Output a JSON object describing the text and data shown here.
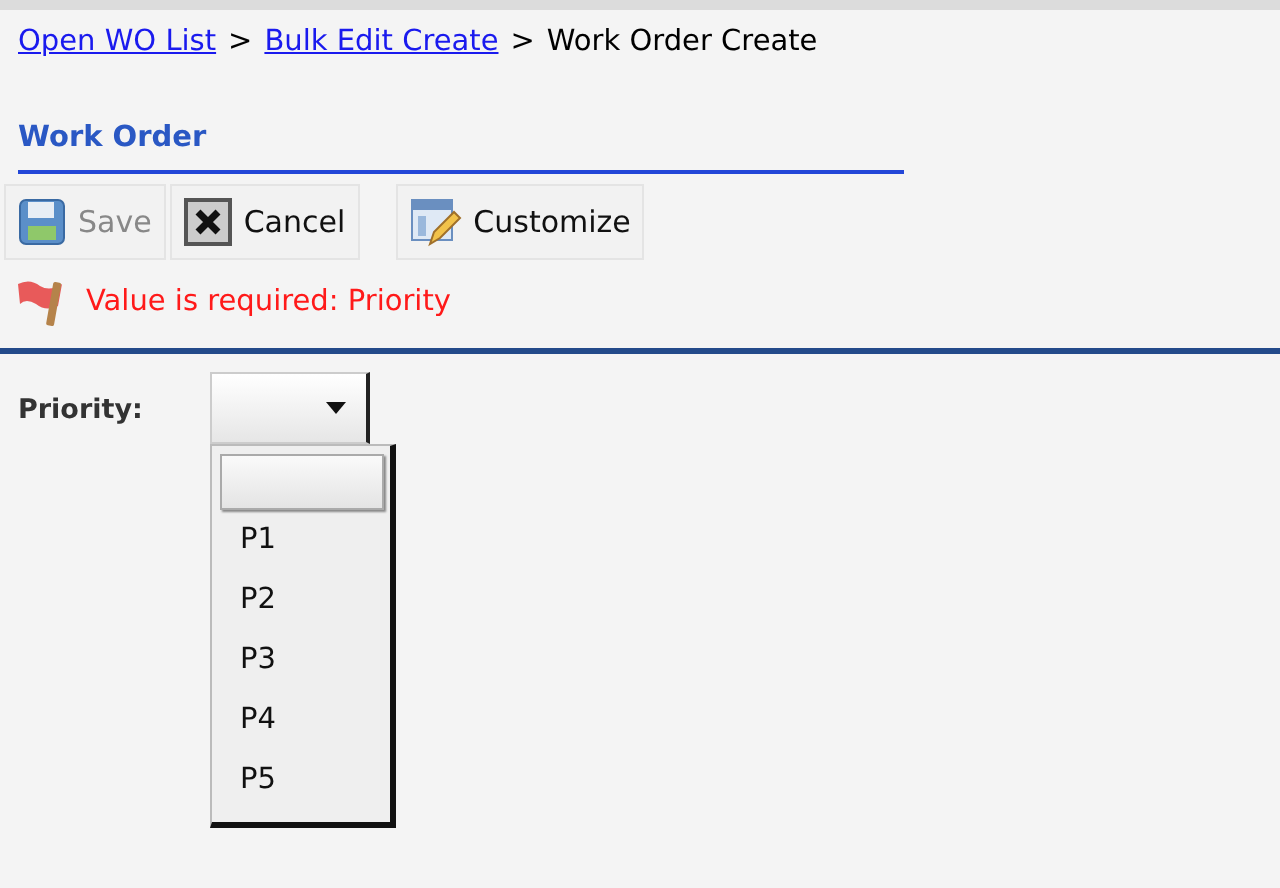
{
  "breadcrumb": {
    "links": [
      "Open WO List",
      "Bulk Edit Create"
    ],
    "separator": ">",
    "current": "Work Order Create"
  },
  "section_title": "Work Order",
  "toolbar": [
    {
      "kind": "save",
      "label": "Save",
      "disabled": true
    },
    {
      "kind": "cancel",
      "label": "Cancel",
      "disabled": false
    },
    {
      "kind": "customize",
      "label": "Customize",
      "disabled": false
    }
  ],
  "error": {
    "message": "Value is required: Priority"
  },
  "field": {
    "label": "Priority:",
    "expanded": true,
    "blank_option": {
      "selected": true
    },
    "options": [
      {
        "label": "P1",
        "selected": false
      },
      {
        "label": "P2",
        "selected": false
      },
      {
        "label": "P3",
        "selected": false
      },
      {
        "label": "P4",
        "selected": false
      },
      {
        "label": "P5",
        "selected": false
      }
    ]
  }
}
